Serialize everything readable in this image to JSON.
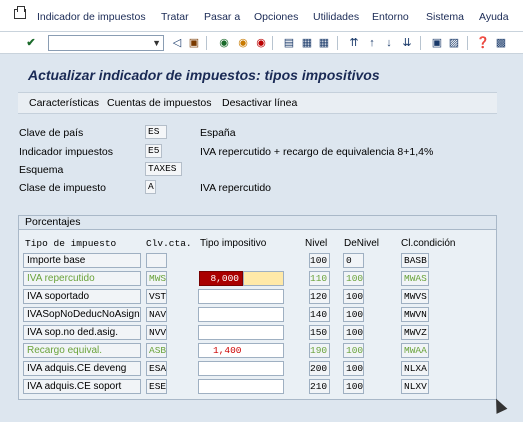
{
  "menu": [
    "Indicador de impuestos",
    "Tratar",
    "Pasar a",
    "Opciones",
    "Utilidades",
    "Entorno",
    "Sistema",
    "Ayuda"
  ],
  "toolbar": {
    "command_value": ""
  },
  "title": "Actualizar indicador de impuestos: tipos impositivos",
  "actions": [
    "Características",
    "Cuentas de impuestos",
    "Desactivar línea"
  ],
  "header": {
    "country_label": "Clave de país",
    "country_value": "ES",
    "country_desc": "España",
    "taxcode_label": "Indicador impuestos",
    "taxcode_value": "E5",
    "taxcode_desc": "IVA repercutido + recargo de equivalencia 8+1,4%",
    "schema_label": "Esquema",
    "schema_value": "TAXES",
    "taxclass_label": "Clase de impuesto",
    "taxclass_value": "A",
    "taxclass_desc": "IVA repercutido"
  },
  "group": {
    "title": "Porcentajes",
    "columns": [
      "Tipo de impuesto",
      "Clv.cta.",
      "Tipo impositivo",
      "Nivel",
      "DeNivel",
      "Cl.condición"
    ],
    "rows": [
      {
        "type": "Importe base",
        "key": "",
        "rate": "",
        "level": "100",
        "from": "0",
        "cond": "BASB"
      },
      {
        "type": "IVA repercutido",
        "key": "MWS",
        "rate": "8,000",
        "level": "110",
        "from": "100",
        "cond": "MWAS"
      },
      {
        "type": "IVA soportado",
        "key": "VST",
        "rate": "",
        "level": "120",
        "from": "100",
        "cond": "MWVS"
      },
      {
        "type": "IVASopNoDeducNoAsign",
        "key": "NAV",
        "rate": "",
        "level": "140",
        "from": "100",
        "cond": "MWVN"
      },
      {
        "type": "IVA sop.no ded.asig.",
        "key": "NVV",
        "rate": "",
        "level": "150",
        "from": "100",
        "cond": "MWVZ"
      },
      {
        "type": "Recargo equival.",
        "key": "ASB",
        "rate": "1,400",
        "level": "190",
        "from": "100",
        "cond": "MWAA"
      },
      {
        "type": "IVA adquis.CE deveng",
        "key": "ESA",
        "rate": "",
        "level": "200",
        "from": "100",
        "cond": "NLXA"
      },
      {
        "type": "IVA adquis.CE soport",
        "key": "ESE",
        "rate": "",
        "level": "210",
        "from": "100",
        "cond": "NLXV"
      }
    ]
  }
}
